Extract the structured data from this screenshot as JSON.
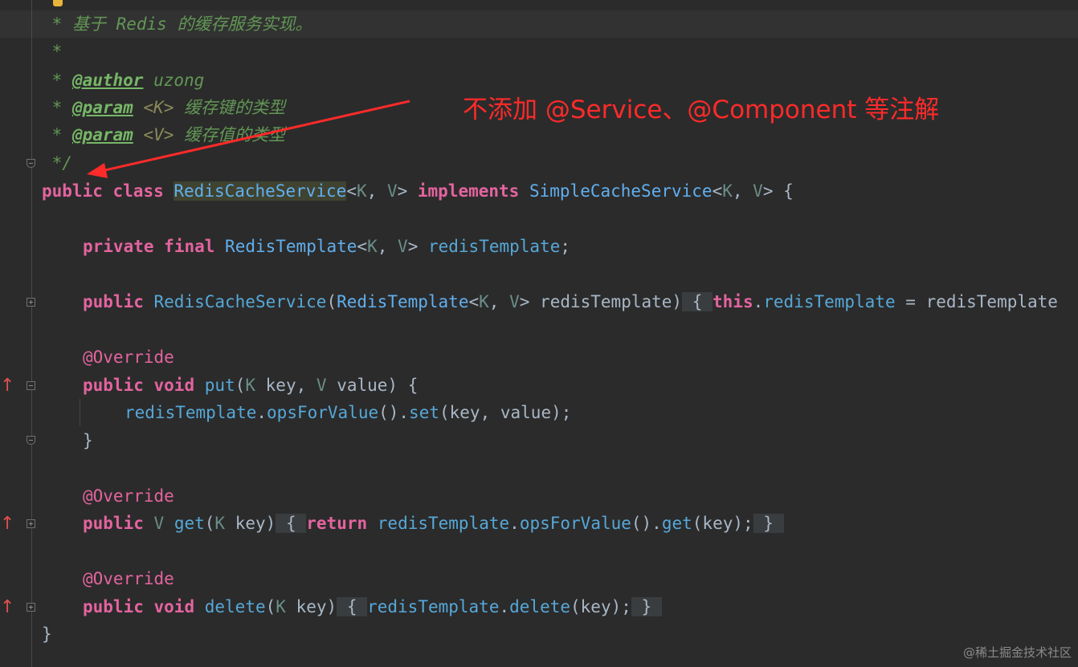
{
  "doc": {
    "lines": [
      {
        "prefix": " * ",
        "text": "基于 Redis 的缓存服务实现。"
      },
      {
        "text": " *"
      },
      {
        "prefix": " * ",
        "tag": "@author",
        "rest": " uzong"
      },
      {
        "prefix": " * ",
        "tag": "@param",
        "tp": " <K>",
        "rest": " 缓存键的类型"
      },
      {
        "prefix": " * ",
        "tag": "@param",
        "tp": " <V>",
        "rest": " 缓存值的类型"
      },
      {
        "text": " */"
      }
    ]
  },
  "keywords": {
    "public": "public",
    "class": "class",
    "implements": "implements",
    "private": "private",
    "final": "final",
    "this": "this",
    "void": "void",
    "return": "return"
  },
  "types": {
    "redis_cache_service": "RedisCacheService",
    "simple_cache_service": "SimpleCacheService",
    "redis_template": "RedisTemplate",
    "K": "K",
    "V": "V"
  },
  "identifiers": {
    "redis_template_field": "redisTemplate",
    "redis_template_param": "redisTemplate",
    "key": "key",
    "value": "value",
    "put": "put",
    "get": "get",
    "delete": "delete",
    "ops_for_value": "opsForValue",
    "set": "set"
  },
  "annotations": {
    "override": "@Override"
  },
  "callout": {
    "text": "不添加 @Service、@Component 等注解"
  },
  "watermark": "@稀土掘金技术社区"
}
